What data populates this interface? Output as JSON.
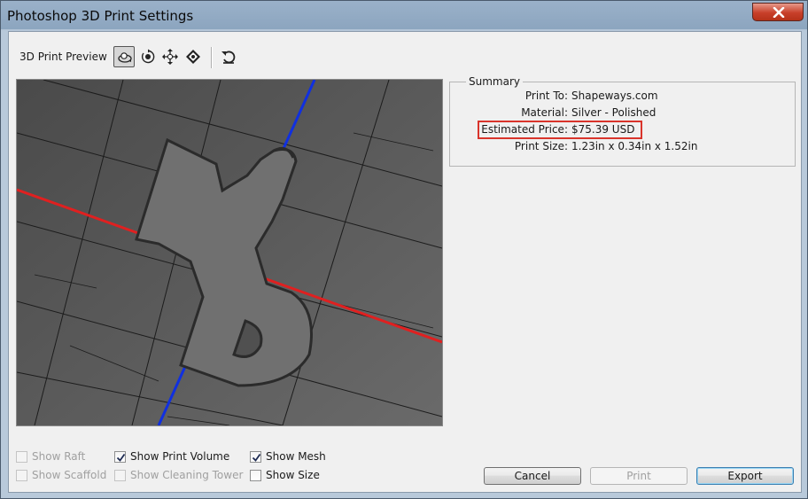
{
  "window": {
    "title": "Photoshop 3D Print Settings",
    "close_icon": "close-icon"
  },
  "toolbar": {
    "preview_label": "3D Print Preview",
    "tools": [
      "orbit-icon",
      "roll-icon",
      "pan-icon",
      "slide-icon",
      "reset-view-icon"
    ],
    "selected_tool": "orbit-icon"
  },
  "summary": {
    "legend": "Summary",
    "rows": [
      {
        "label": "Print To:",
        "value": "Shapeways.com"
      },
      {
        "label": "Material:",
        "value": "Silver - Polished"
      },
      {
        "label": "Estimated Price:",
        "value": "$75.39 USD"
      },
      {
        "label": "Print Size:",
        "value": "1.23in x 0.34in x 1.52in"
      }
    ],
    "highlight_color": "#d9342b"
  },
  "options": {
    "show_raft": {
      "label": "Show Raft",
      "checked": false,
      "enabled": false
    },
    "show_scaffold": {
      "label": "Show Scaffold",
      "checked": false,
      "enabled": false
    },
    "show_print_volume": {
      "label": "Show Print Volume",
      "checked": true,
      "enabled": true
    },
    "show_cleaning_tower": {
      "label": "Show Cleaning Tower",
      "checked": false,
      "enabled": false
    },
    "show_mesh": {
      "label": "Show Mesh",
      "checked": true,
      "enabled": true
    },
    "show_size": {
      "label": "Show Size",
      "checked": false,
      "enabled": true
    }
  },
  "buttons": {
    "cancel": "Cancel",
    "print": "Print",
    "export": "Export"
  },
  "viewport": {
    "model_text": "3D",
    "axis_x_color": "#e02020",
    "axis_y_color": "#1030e0"
  }
}
